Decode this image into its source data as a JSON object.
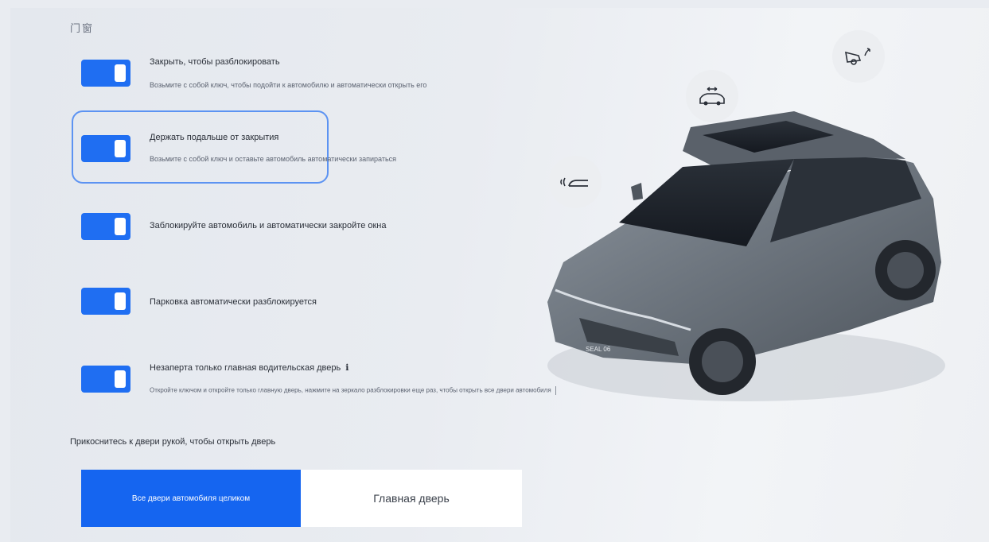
{
  "section_title": "门窗",
  "settings": [
    {
      "title": "Закрыть, чтобы разблокировать",
      "desc": "Возьмите с собой ключ, чтобы подойти к автомобилю и автоматически открыть его",
      "enabled": true
    },
    {
      "title": "Держать подальше от закрытия",
      "desc": "Возьмите с собой ключ и оставьте автомобиль автоматически запираться",
      "enabled": true
    },
    {
      "title": "Заблокируйте автомобиль и автоматически закройте окна",
      "desc": "",
      "enabled": true
    },
    {
      "title": "Парковка автоматически разблокируется",
      "desc": "",
      "enabled": true
    },
    {
      "title": "Незаперта только главная водительская дверь",
      "info_icon": "ℹ",
      "desc": "Откройте ключом и откройте только главную дверь, нажмите на зеркало разблокировки еще раз, чтобы открыть все двери автомобиля",
      "enabled": true
    }
  ],
  "hint": "Прикоснитесь к двери рукой, чтобы открыть дверь",
  "segments": {
    "all": "Все двери автомобиля целиком",
    "main": "Главная дверь"
  },
  "car_badge": "SEAL 06",
  "icons": {
    "approach": "key-approach-icon",
    "car": "car-doors-icon",
    "trunk": "trunk-open-icon"
  },
  "colors": {
    "accent": "#1f6ef2",
    "segment_active": "#1565f0",
    "highlight_border": "#5c93f2"
  }
}
